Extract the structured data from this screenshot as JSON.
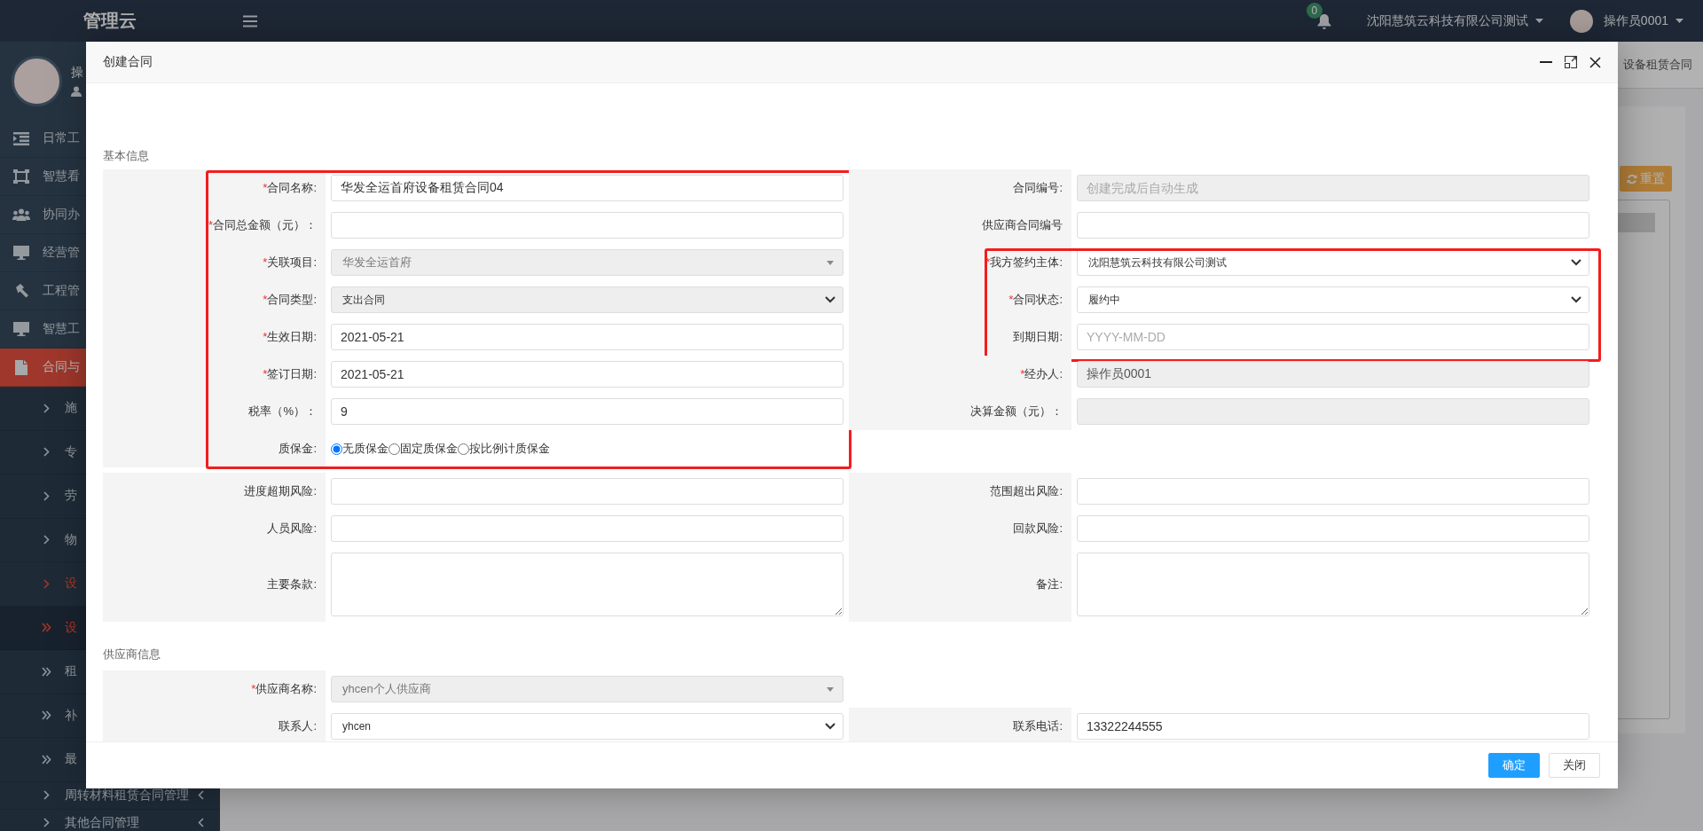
{
  "topbar": {
    "logo": "管理云",
    "notifications": "0",
    "company": "沈阳慧筑云科技有限公司测试",
    "user": "操作员0001"
  },
  "sidebar": {
    "user": "操",
    "menu": [
      {
        "label": "日常工",
        "selected": false
      },
      {
        "label": "智慧看",
        "selected": false
      },
      {
        "label": "协同办",
        "selected": false
      },
      {
        "label": "经营管",
        "selected": false
      },
      {
        "label": "工程管",
        "selected": false
      },
      {
        "label": "智慧工",
        "selected": false
      },
      {
        "label": "合同与",
        "selected": true,
        "children": [
          {
            "label": "施",
            "selected": false
          },
          {
            "label": "专",
            "selected": false
          },
          {
            "label": "劳",
            "selected": false
          },
          {
            "label": "物",
            "selected": false
          },
          {
            "label": "设",
            "selected": true,
            "children": [
              {
                "label": "设",
                "selected": true
              },
              {
                "label": "租",
                "selected": false
              },
              {
                "label": "补",
                "selected": false
              },
              {
                "label": "最",
                "selected": false
              }
            ]
          },
          {
            "label": "周转材料租赁合同管理",
            "selected": false,
            "expanded": false
          },
          {
            "label": "其他合同管理",
            "selected": false,
            "expanded": false
          }
        ]
      }
    ]
  },
  "tabs": [
    "设备租赁合同"
  ],
  "reset_button": "重置",
  "dialog": {
    "title": "创建合同",
    "sections": [
      {
        "title": "基本信息",
        "left_column": [
          {
            "highlighted": true,
            "fields": [
              {
                "mark": "*",
                "label": "合同名称:",
                "kind": "input",
                "value": "华发全运首府设备租赁合同04",
                "disabled": false
              },
              {
                "mark": "*",
                "label": "合同总金额（元）：",
                "kind": "input",
                "disabled": false
              },
              {
                "mark": "*",
                "label": "关联项目:",
                "kind": "combo",
                "value": "华发全运首府",
                "disabled": true
              },
              {
                "mark": "*",
                "label": "合同类型:",
                "kind": "select",
                "value": "支出合同",
                "disabled": true
              },
              {
                "mark": "*",
                "label": "生效日期:",
                "kind": "input",
                "value": "2021-05-21",
                "disabled": false
              },
              {
                "mark": "*",
                "label": "签订日期:",
                "kind": "input",
                "value": "2021-05-21",
                "disabled": false
              },
              {
                "label": "税率（%）：",
                "kind": "input",
                "value": "9",
                "disabled": false
              },
              {
                "label": "质保金:",
                "kind": "radio",
                "options": [
                  {
                    "label": "无质保金",
                    "selected": true
                  },
                  {
                    "label": "固定质保金",
                    "selected": false
                  },
                  {
                    "label": "按比例计质保金",
                    "selected": false
                  }
                ]
              }
            ]
          }
        ],
        "right_column": [
          {
            "fields": [
              {
                "label": "合同编号:",
                "kind": "input",
                "placeholder": "创建完成后自动生成",
                "disabled": true
              },
              {
                "label": "供应商合同编号",
                "kind": "input",
                "disabled": false
              }
            ]
          },
          {
            "highlighted": true,
            "fields": [
              {
                "mark": "*",
                "label": "我方签约主体:",
                "kind": "select",
                "value": "沈阳慧筑云科技有限公司测试",
                "disabled": false
              },
              {
                "mark": "*",
                "label": "合同状态:",
                "kind": "select",
                "value": "履约中",
                "disabled": false
              },
              {
                "label": "到期日期:",
                "kind": "input",
                "placeholder": "YYYY-MM-DD",
                "disabled": false
              }
            ]
          },
          {
            "fields": [
              {
                "mark": "*",
                "label": "经办人:",
                "kind": "input",
                "value": "操作员0001",
                "disabled": true
              },
              {
                "label": "决算金额（元）：",
                "kind": "input",
                "disabled": true
              }
            ]
          }
        ],
        "rows": [
          [
            {
              "label": "进度超期风险:",
              "kind": "input",
              "disabled": false
            },
            {
              "label": "范围超出风险:",
              "kind": "input",
              "disabled": false
            }
          ],
          [
            {
              "label": "人员风险:",
              "kind": "input",
              "disabled": false
            },
            {
              "label": "回款风险:",
              "kind": "input",
              "disabled": false
            }
          ],
          [
            {
              "label": "主要条款:",
              "kind": "textarea",
              "disabled": false
            },
            {
              "label": "备注:",
              "kind": "textarea",
              "disabled": false
            }
          ]
        ]
      },
      {
        "title": "供应商信息",
        "rows": [
          [
            {
              "mark": "*",
              "label": "供应商名称:",
              "kind": "combo",
              "value": "yhcen个人供应商",
              "disabled": true
            }
          ],
          [
            {
              "label": "联系人:",
              "kind": "select",
              "value": "yhcen",
              "disabled": false
            },
            {
              "label": "联系电话:",
              "kind": "input",
              "value": "13322244555",
              "disabled": false
            }
          ]
        ]
      }
    ],
    "buttons": [
      {
        "label": "确定",
        "kind": "primary"
      },
      {
        "label": "关闭",
        "kind": "default"
      }
    ]
  }
}
